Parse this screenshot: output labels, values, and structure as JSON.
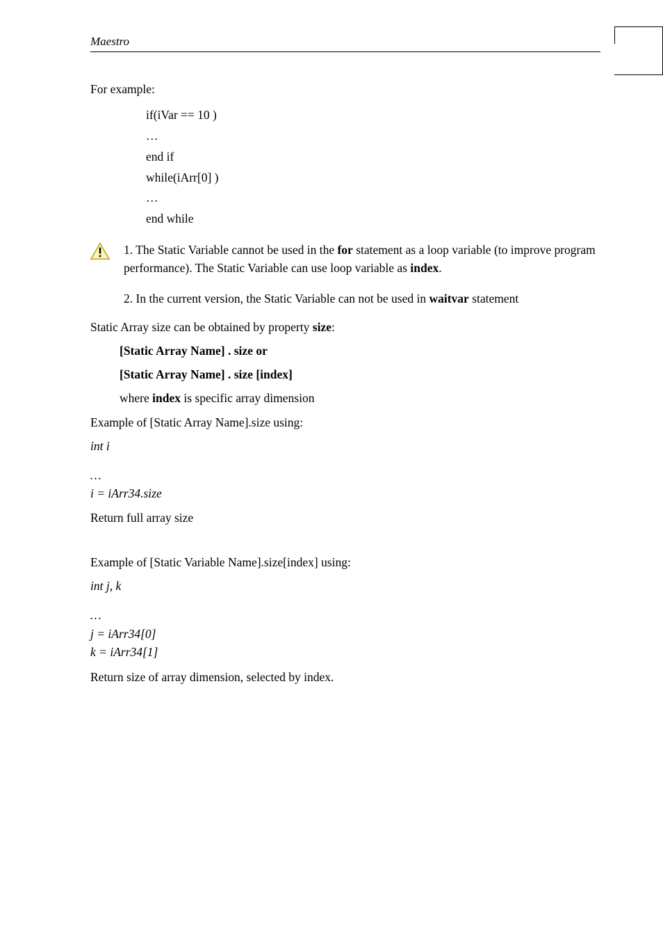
{
  "header": {
    "title": "Maestro"
  },
  "content": {
    "for_example": "For example:",
    "code": {
      "line1": "if(iVar == 10 )",
      "line2": "…",
      "line3": "end if",
      "line4": "while(iArr[0] )",
      "line5": "…",
      "line6": "end while"
    },
    "note1_prefix": "1. The Static Variable cannot be used in the ",
    "note1_for": "for",
    "note1_mid": " statement as a loop variable (to improve program performance). The Static Variable can use loop variable as ",
    "note1_index": "index",
    "note1_end": ".",
    "note2_prefix": "2. In the current version, the Static Variable can not be used in ",
    "note2_waitvar": "waitvar",
    "note2_suffix": " statement",
    "size_intro_pre": "Static Array size can be obtained by property ",
    "size_intro_bold": "size",
    "size_intro_post": ":",
    "syntax1": "[Static Array Name] . size or",
    "syntax2": "[Static Array Name] . size [index]",
    "where_pre": "where ",
    "where_bold": "index",
    "where_post": " is specific array dimension",
    "example1_title": "Example of [Static Array Name].size using:",
    "int_i": "int i",
    "ellipsis1": "…",
    "i_assign": "i = iArr34.size",
    "return1": "Return full array size",
    "example2_title": "Example of [Static Variable Name].size[index] using:",
    "int_jk": "int  j, k",
    "ellipsis2": "…",
    "j_assign": "j = iArr34[0]",
    "k_assign": "k = iArr34[1]",
    "return2": "Return size of array dimension, selected by index."
  }
}
